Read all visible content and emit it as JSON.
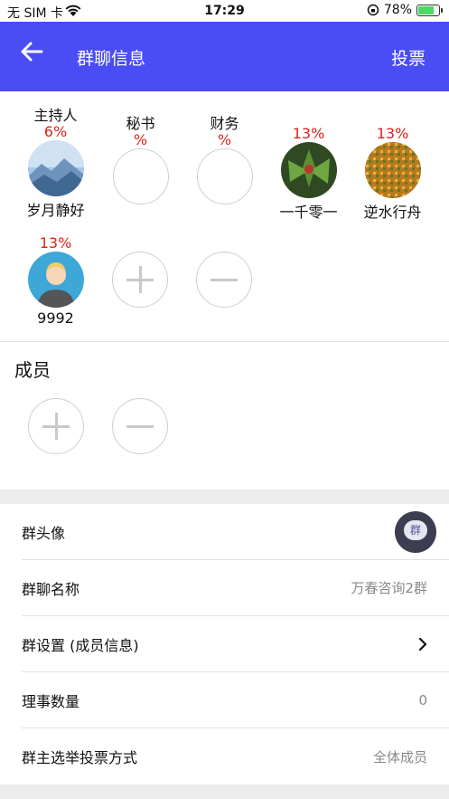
{
  "status_bar": {
    "carrier": "无 SIM 卡",
    "time": "17:29",
    "battery": "78%"
  },
  "nav": {
    "title": "群聊信息",
    "action": "投票"
  },
  "roles": [
    {
      "role": "主持人",
      "percent": "6%",
      "name": "岁月静好",
      "avatar": "mountain-photo"
    },
    {
      "role": "秘书",
      "percent": "%",
      "name": ""
    },
    {
      "role": "财务",
      "percent": "%",
      "name": ""
    },
    {
      "role": "",
      "percent": "13%",
      "name": "一千零一",
      "avatar": "plant-photo"
    },
    {
      "role": "",
      "percent": "13%",
      "name": "逆水行舟",
      "avatar": "pattern-photo"
    },
    {
      "role": "",
      "percent": "13%",
      "name": "9992",
      "avatar": "person-avatar"
    }
  ],
  "members": {
    "label": "成员"
  },
  "settings": [
    {
      "label": "群头像",
      "value": "群"
    },
    {
      "label": "群聊名称",
      "value": "万春咨询2群"
    },
    {
      "label": "群设置 (成员信息)",
      "value": ""
    },
    {
      "label": "理事数量",
      "value": "0"
    },
    {
      "label": "群主选举投票方式",
      "value": "全体成员"
    }
  ],
  "colors": {
    "nav": "#4a4cf6",
    "percent": "#e0201a",
    "battery": "#4cd964"
  }
}
